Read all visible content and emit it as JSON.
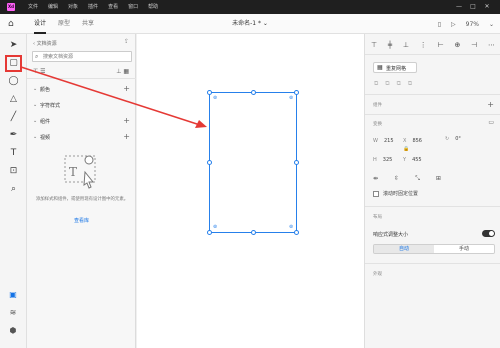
{
  "titlebar": {
    "logo": "Xd",
    "menu": [
      "文件",
      "编辑",
      "对象",
      "插件",
      "查看",
      "窗口",
      "帮助"
    ],
    "controls": [
      "—",
      "□",
      "✕"
    ]
  },
  "appbar": {
    "tabs": [
      {
        "label": "设计",
        "active": true
      },
      {
        "label": "原型",
        "active": false
      },
      {
        "label": "共享",
        "active": false
      }
    ],
    "document_title": "未命名-1 *",
    "zoom": "97%"
  },
  "tools": [
    {
      "name": "select-tool-icon",
      "glyph": "➤"
    },
    {
      "name": "rectangle-tool-icon",
      "glyph": "▢",
      "selected": true
    },
    {
      "name": "ellipse-tool-icon",
      "glyph": "◯"
    },
    {
      "name": "polygon-tool-icon",
      "glyph": "△"
    },
    {
      "name": "line-tool-icon",
      "glyph": "╱"
    },
    {
      "name": "pen-tool-icon",
      "glyph": "✒"
    },
    {
      "name": "text-tool-icon",
      "glyph": "T"
    },
    {
      "name": "artboard-tool-icon",
      "glyph": "⊡"
    },
    {
      "name": "zoom-tool-icon",
      "glyph": "⌕"
    }
  ],
  "bottom_tools": [
    {
      "name": "assets-panel-icon",
      "glyph": "▣"
    },
    {
      "name": "layers-panel-icon",
      "glyph": "≋"
    },
    {
      "name": "plugins-panel-icon",
      "glyph": "⬢"
    }
  ],
  "assets": {
    "header": "‹ 文档资源",
    "search_placeholder": "搜索文档资源",
    "sections": [
      {
        "label": "颜色"
      },
      {
        "label": "字符样式"
      },
      {
        "label": "组件"
      },
      {
        "label": "视频"
      }
    ],
    "empty_text": "添加样式和组件，或使用现有设计图中的元素。",
    "empty_link": "查看库"
  },
  "props": {
    "repeat_grid": "重复网格",
    "components_title": "组件",
    "transform_title": "变换",
    "w_label": "W",
    "w_value": "215",
    "x_label": "X",
    "x_value": "856",
    "angle_value": "0°",
    "h_label": "H",
    "h_value": "325",
    "y_label": "Y",
    "y_value": "455",
    "fix_label": "滚动时固定位置",
    "layout_title": "布局",
    "responsive_label": "响应式调整大小",
    "responsive_on": true,
    "seg_auto": "自动",
    "seg_manual": "手动",
    "appearance_title": "外观"
  },
  "colors": {
    "accent": "#2680eb",
    "annotation": "#e53935",
    "logo_bg": "#ff61f6",
    "titlebar_bg": "#1f1f1f"
  }
}
